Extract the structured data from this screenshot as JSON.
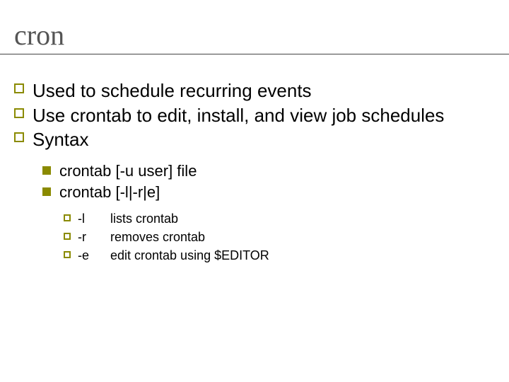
{
  "title": "cron",
  "bullets": [
    {
      "text": "Used to schedule recurring events"
    },
    {
      "text": "Use crontab to edit, install, and view job schedules"
    },
    {
      "text": "Syntax"
    }
  ],
  "syntax": [
    {
      "text": "crontab [-u user] file"
    },
    {
      "text": "crontab [-l|-r|e]"
    }
  ],
  "flags": [
    {
      "flag": "-l",
      "desc": "lists crontab"
    },
    {
      "flag": "-r",
      "desc": "removes crontab"
    },
    {
      "flag": "-e",
      "desc": "edit crontab using $EDITOR"
    }
  ]
}
